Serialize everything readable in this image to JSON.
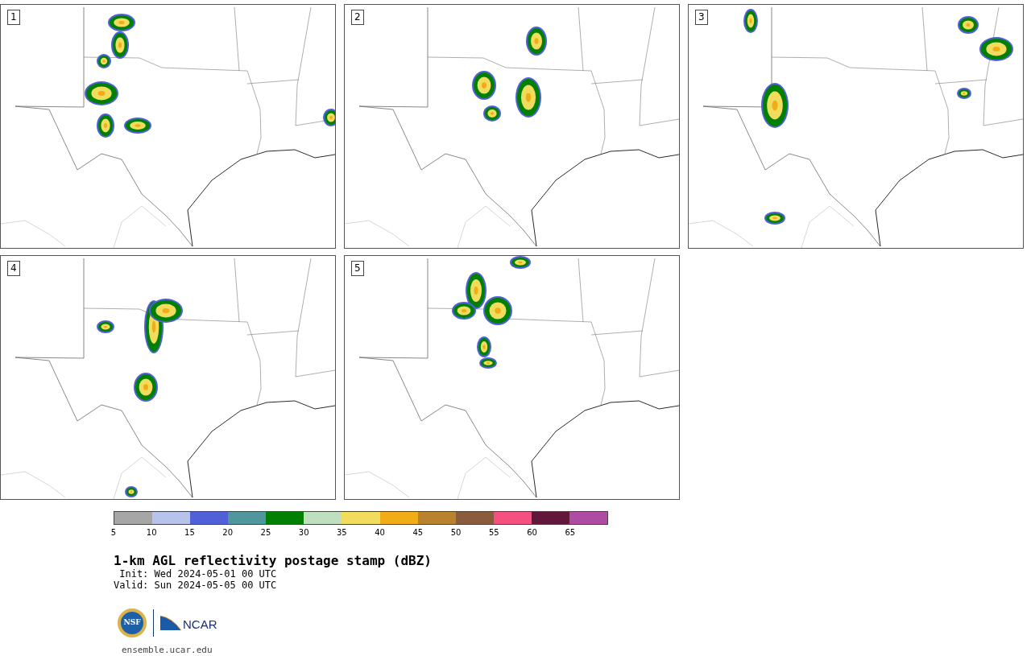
{
  "panels": [
    {
      "label": "1"
    },
    {
      "label": "2"
    },
    {
      "label": "3"
    },
    {
      "label": "4"
    },
    {
      "label": "5"
    }
  ],
  "colorbar": {
    "segments": [
      {
        "color": "#a6a6a6"
      },
      {
        "color": "#b8c3ec"
      },
      {
        "color": "#5060d8"
      },
      {
        "color": "#4f979a"
      },
      {
        "color": "#008000"
      },
      {
        "color": "#c0dfc0"
      },
      {
        "color": "#f1dc5e"
      },
      {
        "color": "#f0ad17"
      },
      {
        "color": "#b9822f"
      },
      {
        "color": "#8b5b3d"
      },
      {
        "color": "#f45080"
      },
      {
        "color": "#63173a"
      },
      {
        "color": "#ae4ca4"
      }
    ],
    "ticks": [
      "5",
      "10",
      "15",
      "20",
      "25",
      "30",
      "35",
      "40",
      "45",
      "50",
      "55",
      "60",
      "65"
    ]
  },
  "title": "1-km AGL reflectivity postage stamp (dBZ)",
  "init": " Init: Wed 2024-05-01 00 UTC",
  "valid": "Valid: Sun 2024-05-05 00 UTC",
  "logos": {
    "nsf": "NSF",
    "ncar": "NCAR"
  },
  "url": "ensemble.ucar.edu"
}
